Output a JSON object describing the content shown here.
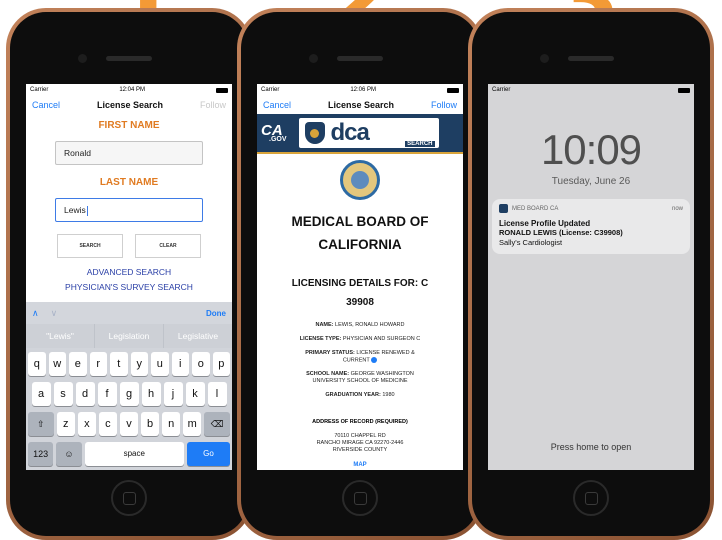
{
  "steps": [
    "1",
    "2",
    "3"
  ],
  "phone1": {
    "status": {
      "carrier": "Carrier",
      "time": "12:04 PM"
    },
    "nav": {
      "left": "Cancel",
      "title": "License Search",
      "right": "Follow"
    },
    "first_name_label": "FIRST NAME",
    "first_name_value": "Ronald",
    "last_name_label": "LAST NAME",
    "last_name_value": "Lewis",
    "search_button": "SEARCH",
    "clear_button": "CLEAR",
    "advanced_search": "ADVANCED SEARCH",
    "survey_search": "PHYSICIAN'S SURVEY SEARCH",
    "keyboard": {
      "done": "Done",
      "suggestions": [
        "\"Lewis\"",
        "Legislation",
        "Legislative"
      ],
      "row1": [
        "q",
        "w",
        "e",
        "r",
        "t",
        "y",
        "u",
        "i",
        "o",
        "p"
      ],
      "row2": [
        "a",
        "s",
        "d",
        "f",
        "g",
        "h",
        "j",
        "k",
        "l"
      ],
      "row3": [
        "z",
        "x",
        "c",
        "v",
        "b",
        "n",
        "m"
      ],
      "num_key": "123",
      "space_key": "space",
      "go_key": "Go"
    }
  },
  "phone2": {
    "status": {
      "carrier": "Carrier",
      "time": "12:06 PM"
    },
    "nav": {
      "left": "Cancel",
      "title": "License Search",
      "right": "Follow"
    },
    "banner": {
      "ca": "CA",
      "gov": ".GOV",
      "dca": "dca",
      "search": "SEARCH"
    },
    "board_title_1": "MEDICAL BOARD OF",
    "board_title_2": "CALIFORNIA",
    "details_1": "LICENSING DETAILS FOR: C",
    "details_2": "39908",
    "name_label": "NAME:",
    "name_value": "LEWIS, RONALD HOWARD",
    "type_label": "LICENSE TYPE:",
    "type_value": "PHYSICIAN AND SURGEON C",
    "status_label": "PRIMARY STATUS:",
    "status_value_1": "LICENSE RENEWED &",
    "status_value_2": "CURRENT",
    "school_label": "SCHOOL NAME:",
    "school_value_1": "GEORGE WASHINGTON",
    "school_value_2": "UNIVERSITY SCHOOL OF MEDICINE",
    "grad_label": "GRADUATION YEAR:",
    "grad_value": "1980",
    "address_head": "ADDRESS OF RECORD (REQUIRED)",
    "address_1": "70110 CHAPPEL RD",
    "address_2": "RANCHO MIRAGE CA 92270-2446",
    "address_3": "RIVERSIDE COUNTY",
    "map_link": "MAP"
  },
  "phone3": {
    "status": {
      "carrier": "Carrier"
    },
    "time": "10:09",
    "date": "Tuesday, June 26",
    "notification": {
      "app": "MED BOARD CA",
      "when": "now",
      "title": "License Profile Updated",
      "line1": "RONALD LEWIS (License: C39908)",
      "line2": "Sally's Cardiologist"
    },
    "press_home": "Press home to open"
  }
}
